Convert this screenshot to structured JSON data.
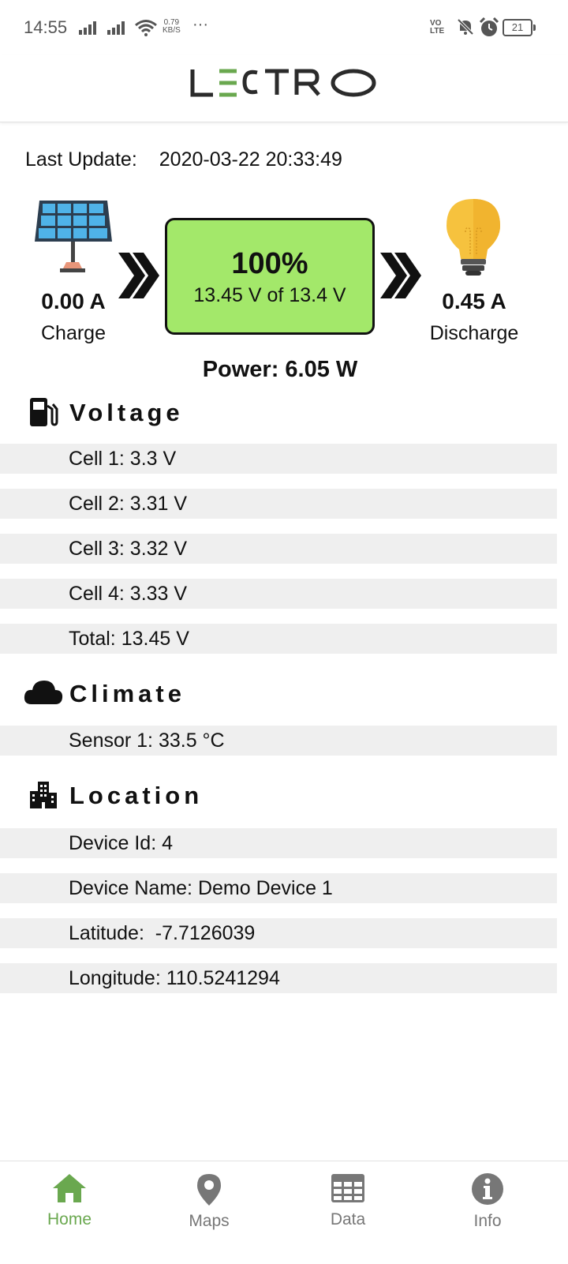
{
  "status_bar": {
    "time": "14:55",
    "net_speed_value": "0.79",
    "net_speed_unit": "KB/S",
    "more": "···",
    "volte_top": "VO",
    "volte_bottom": "LTE",
    "battery": "21"
  },
  "app": {
    "logo_text": "LECTRO",
    "brand_color": "#6aa84f"
  },
  "last_update": {
    "label": "Last Update:",
    "value": "2020-03-22 20:33:49"
  },
  "flow": {
    "charge_value": "0.00 A",
    "charge_label": "Charge",
    "battery_percent": "100%",
    "battery_voltage": "13.45 V of 13.4 V",
    "discharge_value": "0.45 A",
    "discharge_label": "Discharge",
    "power": "Power: 6.05 W",
    "battery_color": "#a3e86a"
  },
  "voltage": {
    "title": "Voltage",
    "icon": "fuel-pump-icon",
    "rows": [
      "Cell 1: 3.3 V",
      "Cell 2: 3.31 V",
      "Cell 3: 3.32 V",
      "Cell 4: 3.33 V",
      "Total: 13.45 V"
    ]
  },
  "climate": {
    "title": "Climate",
    "icon": "cloud-icon",
    "rows": [
      "Sensor 1: 33.5 °C"
    ]
  },
  "location": {
    "title": "Location",
    "icon": "building-icon",
    "rows": [
      "Device Id: 4",
      "Device Name: Demo Device 1",
      "Latitude:  -7.7126039",
      "Longitude: 110.5241294"
    ]
  },
  "bottom_nav": {
    "items": [
      {
        "label": "Home",
        "icon": "home-icon",
        "active": true
      },
      {
        "label": "Maps",
        "icon": "map-pin-icon",
        "active": false
      },
      {
        "label": "Data",
        "icon": "table-icon",
        "active": false
      },
      {
        "label": "Info",
        "icon": "info-icon",
        "active": false
      }
    ]
  }
}
